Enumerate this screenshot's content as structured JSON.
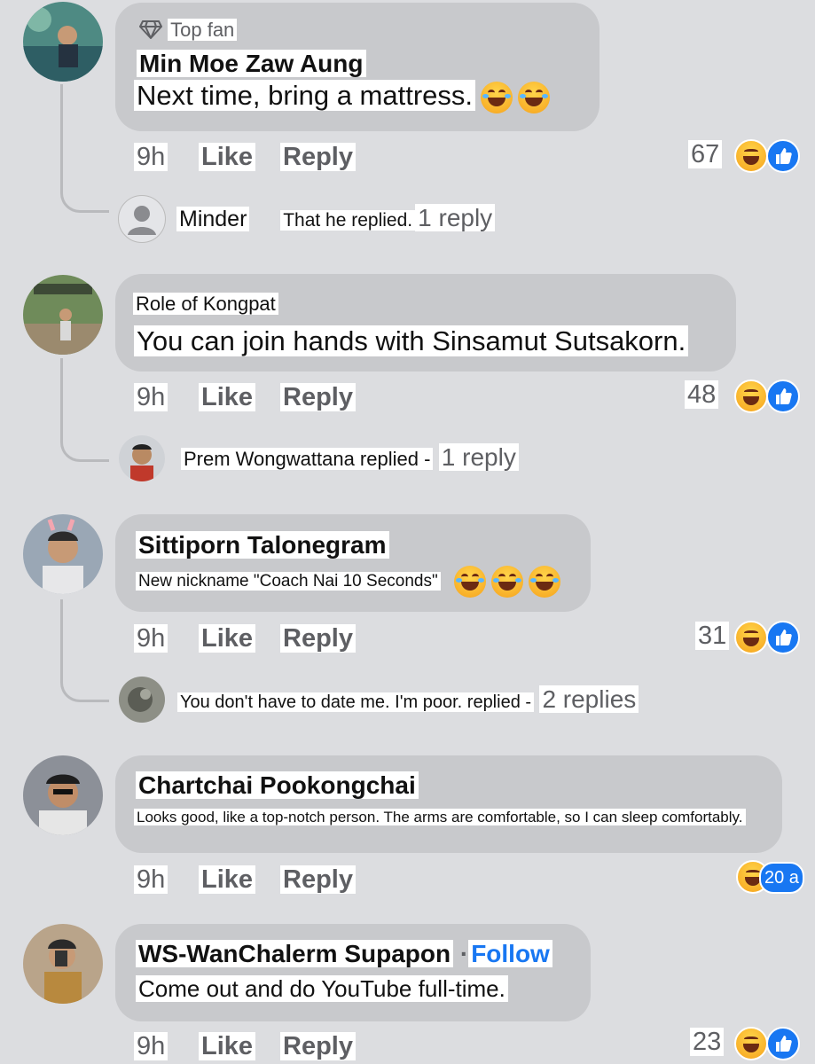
{
  "comments": [
    {
      "badge": "Top fan",
      "author": "Min Moe Zaw Aung",
      "text": "Next time, bring a mattress.",
      "time": "9h",
      "like": "Like",
      "reply": "Reply",
      "reactions": "67",
      "thread": {
        "author": "Minder",
        "snippet": "That he replied.",
        "count": "1 reply"
      }
    },
    {
      "author": "Role of Kongpat",
      "text": "You can join hands with Sinsamut Sutsakorn.",
      "time": "9h",
      "like": "Like",
      "reply": "Reply",
      "reactions": "48",
      "thread": {
        "snippet": "Prem Wongwattana replied -",
        "count": "1 reply"
      }
    },
    {
      "author": "Sittiporn Talonegram",
      "text": "New nickname \"Coach Nai 10 Seconds\"",
      "time": "9h",
      "like": "Like",
      "reply": "Reply",
      "reactions": "31",
      "thread": {
        "snippet": "You don't have to date me. I'm poor. replied -",
        "count": "2 replies"
      }
    },
    {
      "author": "Chartchai Pookongchai",
      "text": "Looks good, like a top-notch person. The arms are comfortable, so I can sleep comfortably.",
      "time": "9h",
      "like": "Like",
      "reply": "Reply",
      "reactions": "20 a"
    },
    {
      "author": "WS-WanChalerm Supapon",
      "separator": "·",
      "follow": "Follow",
      "text": "Come out and do YouTube full-time.",
      "time": "9h",
      "like": "Like",
      "reply": "Reply",
      "reactions": "23"
    }
  ],
  "colors": {
    "background": "#dcdde0",
    "bubble": "#c8c9cc",
    "link": "#1877f2",
    "like_reaction": "#1877f2",
    "haha_reaction": "#f6a21d"
  },
  "icons": [
    "diamond-icon",
    "haha-emoji",
    "like-reaction-icon",
    "haha-reaction-icon",
    "default-avatar-icon"
  ]
}
